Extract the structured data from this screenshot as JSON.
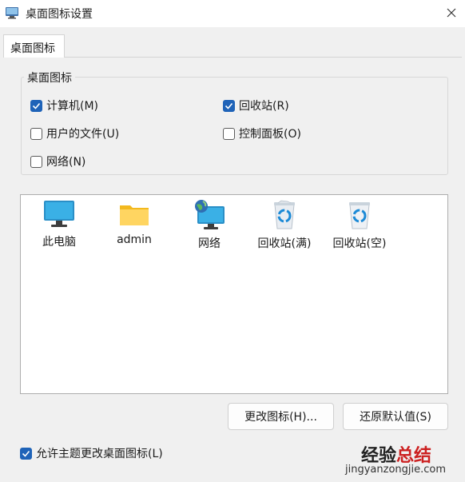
{
  "window": {
    "title": "桌面图标设置"
  },
  "tabs": [
    {
      "label": "桌面图标"
    }
  ],
  "group": {
    "legend": "桌面图标",
    "options": [
      {
        "label": "计算机(M)",
        "checked": true
      },
      {
        "label": "回收站(R)",
        "checked": true
      },
      {
        "label": "用户的文件(U)",
        "checked": false
      },
      {
        "label": "控制面板(O)",
        "checked": false
      },
      {
        "label": "网络(N)",
        "checked": false
      }
    ]
  },
  "icons": [
    {
      "label": "此电脑",
      "icon": "monitor-icon"
    },
    {
      "label": "admin",
      "icon": "folder-icon"
    },
    {
      "label": "网络",
      "icon": "network-icon"
    },
    {
      "label": "回收站(满)",
      "icon": "recycle-bin-full-icon"
    },
    {
      "label": "回收站(空)",
      "icon": "recycle-bin-empty-icon"
    }
  ],
  "buttons": {
    "change_icon": "更改图标(H)...",
    "restore_default": "还原默认值(S)"
  },
  "allow_themes": {
    "label": "允许主题更改桌面图标(L)",
    "checked": true
  },
  "watermark": {
    "text_part1": "经验",
    "text_part2": "总结",
    "url": "jingyanzongjie.com"
  },
  "colors": {
    "accent": "#1f63b8",
    "panel_bg": "#f0f0f0"
  }
}
